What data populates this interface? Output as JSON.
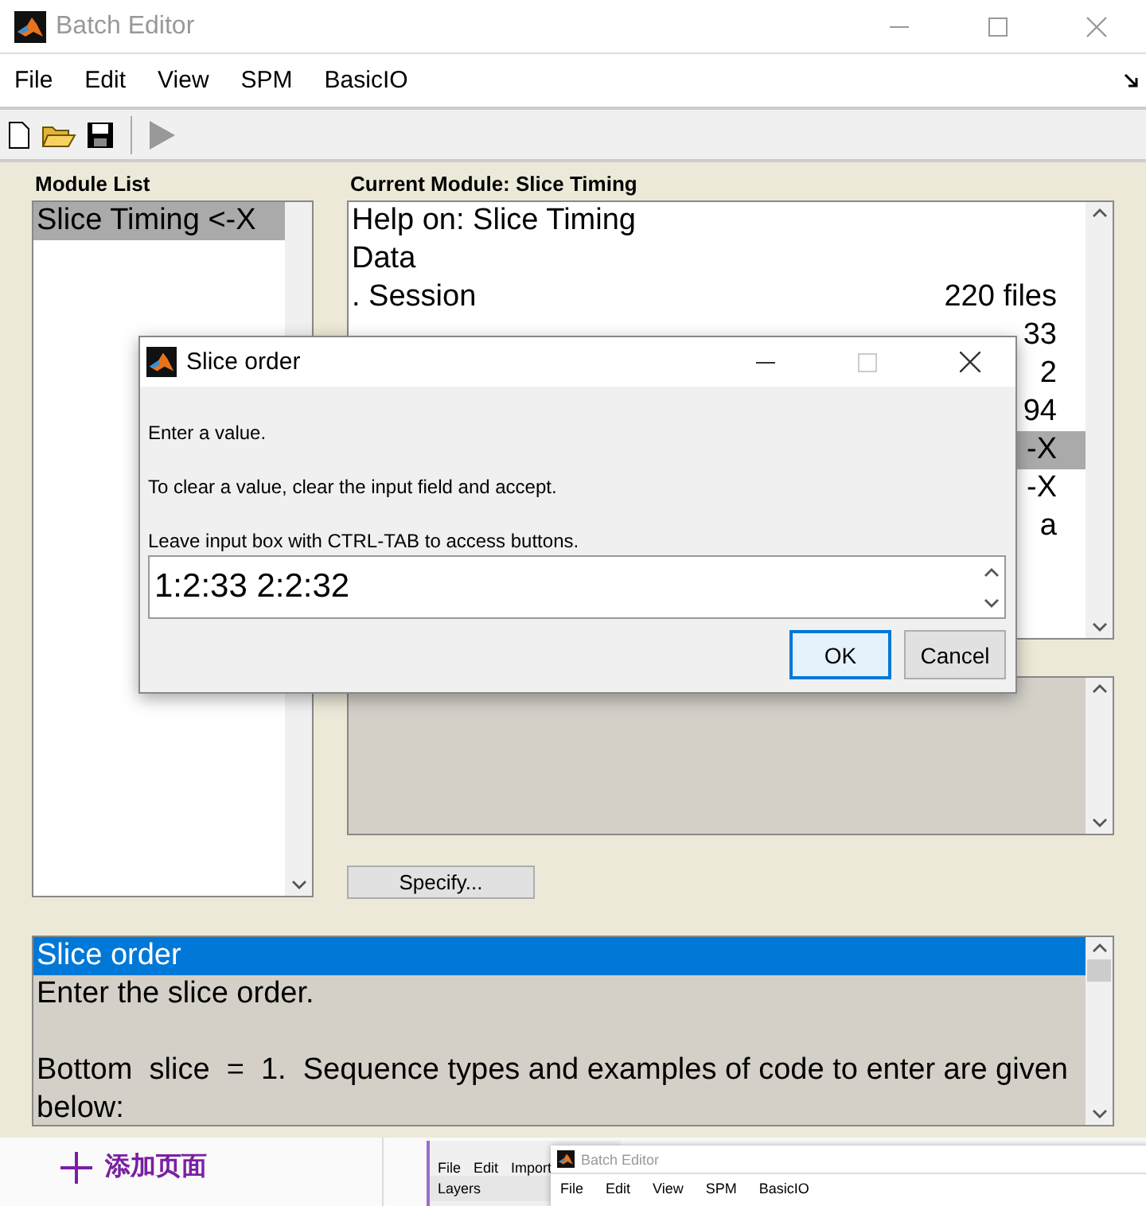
{
  "window": {
    "title": "Batch Editor"
  },
  "menu": [
    "File",
    "Edit",
    "View",
    "SPM",
    "BasicIO"
  ],
  "module_list": {
    "label": "Module List",
    "items": [
      {
        "label": "Slice Timing <-X",
        "selected": true
      }
    ]
  },
  "current_module": {
    "label": "Current Module: Slice Timing",
    "rows": [
      {
        "label": "Help on: Slice Timing",
        "selected": false
      },
      {
        "label": "Data",
        "selected": false
      },
      {
        "label": ". Session",
        "value": "220 files",
        "selected": false
      },
      {
        "value": "33",
        "selected": false
      },
      {
        "value": "2",
        "selected": false
      },
      {
        "value": "94",
        "selected": false
      },
      {
        "value": "-X",
        "selected": true
      },
      {
        "value": "-X",
        "selected": false
      },
      {
        "value": "a",
        "selected": false
      }
    ]
  },
  "specify_button": "Specify...",
  "help": {
    "title": {
      "text": "Slice order",
      "selected": true
    },
    "paragraphs": [
      "Enter the slice order.",
      "Bottom  slice  =  1.  Sequence types and examples of code to enter are given below:"
    ]
  },
  "dialog": {
    "title": "Slice order",
    "messages": [
      "Enter a value.",
      "To clear a value, clear the input field and accept.",
      "Leave input box with CTRL-TAB to access buttons."
    ],
    "value": "1:2:33 2:2:32",
    "buttons": [
      {
        "label": "OK",
        "default": true
      },
      {
        "label": "Cancel",
        "default": false
      }
    ]
  },
  "desktop": {
    "add_page": "添加页面",
    "back_window": {
      "menu": [
        "File",
        "Edit",
        "Import"
      ],
      "panel": "Layers"
    },
    "mini_window": {
      "title": "Batch Editor",
      "menu": [
        "File",
        "Edit",
        "View",
        "SPM",
        "BasicIO"
      ]
    }
  }
}
